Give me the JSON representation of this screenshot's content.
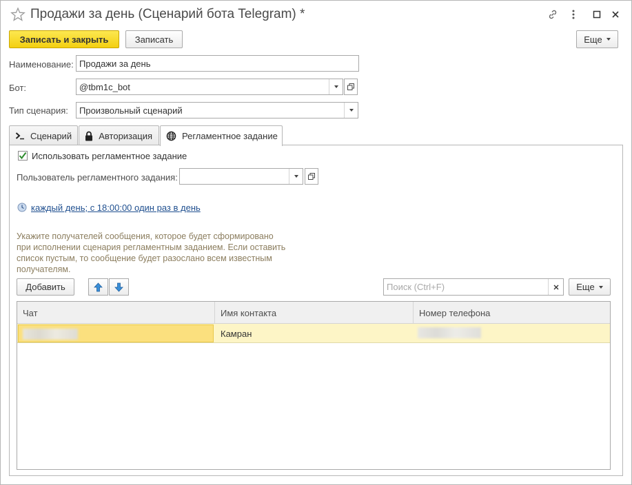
{
  "window": {
    "title": "Продажи за день (Сценарий бота Telegram) *"
  },
  "toolbar": {
    "save_close_label": "Записать и закрыть",
    "save_label": "Записать",
    "more_label": "Еще"
  },
  "form": {
    "name_label": "Наименование:",
    "name_value": "Продажи за день",
    "bot_label": "Бот:",
    "bot_value": "@tbm1c_bot",
    "scenario_type_label": "Тип сценария:",
    "scenario_type_value": "Произвольный сценарий"
  },
  "tabs": [
    {
      "label": "Сценарий",
      "icon": "terminal-icon",
      "active": false
    },
    {
      "label": "Авторизация",
      "icon": "lock-icon",
      "active": false
    },
    {
      "label": "Регламентное задание",
      "icon": "globe-icon",
      "active": true
    }
  ],
  "schedule_tab": {
    "use_job_label": "Использовать регламентное задание",
    "use_job_checked": true,
    "job_user_label": "Пользователь регламентного задания:",
    "job_user_value": "",
    "schedule_link": "каждый день; с 18:00:00 один раз в день",
    "hint_text": "Укажите получателей сообщения, которое будет сформировано при исполнении сценария регламентным заданием. Если оставить список пустым, то сообщение будет разослано всем известным получателям.",
    "add_label": "Добавить",
    "search_placeholder": "Поиск (Ctrl+F)",
    "more_label": "Еще"
  },
  "table": {
    "columns": [
      "Чат",
      "Имя контакта",
      "Номер телефона"
    ],
    "rows": [
      {
        "chat": "",
        "contact": "Камран",
        "phone": ""
      }
    ]
  },
  "colors": {
    "primary_button": "#f3cf10",
    "selected_row": "#fdf5c6",
    "link": "#1f4f8f",
    "hint": "#8b7d5e"
  }
}
